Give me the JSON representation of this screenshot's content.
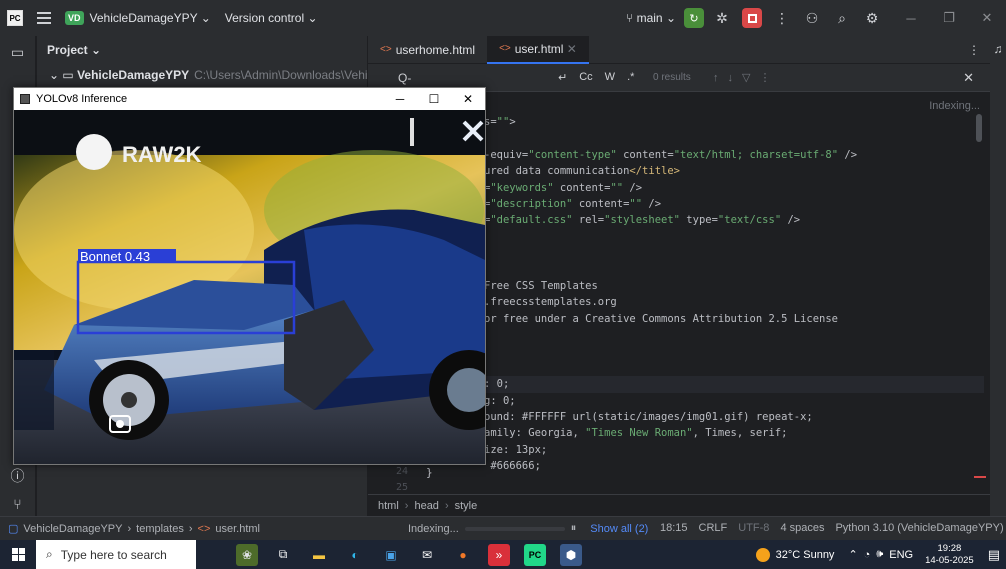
{
  "titlebar": {
    "project_badge": "VD",
    "project_name": "VehicleDamageYPY",
    "version_control": "Version control",
    "branch": "main"
  },
  "project_panel": {
    "title": "Project",
    "root_name": "VehicleDamageYPY",
    "root_path": "C:\\Users\\Admin\\Downloads\\VehicleDamage"
  },
  "editor": {
    "tabs": [
      {
        "label": "userhome.html"
      },
      {
        "label": "user.html"
      }
    ],
    "find": {
      "query_placeholder": "Q-",
      "opt_case": "Cc",
      "opt_word": "W",
      "opt_regex": ".*",
      "results": "0 results"
    },
    "indexing_label": "Indexing...",
    "code_lines": [
      {
        "t": "s=\"\">"
      },
      {
        "t": ""
      },
      {
        "t": "-equiv=\"content-type\" content=\"text/html; charset=utf-8\" />"
      },
      {
        "t": "ured data communication</title>"
      },
      {
        "t": "=\"keywords\" content=\"\" />"
      },
      {
        "t": "=\"description\" content=\"\" />"
      },
      {
        "t": "=\"default.css\" rel=\"stylesheet\" type=\"text/css\" />"
      },
      {
        "t": ""
      },
      {
        "t": ""
      },
      {
        "t": ""
      },
      {
        "t": "Free CSS Templates"
      },
      {
        "t": ".freecsstemplates.org"
      },
      {
        "t": "or free under a Creative Commons Attribution 2.5 License"
      },
      {
        "t": ""
      },
      {
        "t": ""
      },
      {
        "t": ""
      },
      {
        "t": ": 0;"
      },
      {
        "t": "g: 0;"
      },
      {
        "t": "ound: #FFFFFF url(static/images/img01.gif) repeat-x;"
      },
      {
        "t": "amily: Georgia, \"Times New Roman\", Times, serif;"
      },
      {
        "t": "ize: 13px;"
      },
      {
        "t": " #666666;"
      }
    ],
    "gutter": [
      "24",
      "25"
    ],
    "closing_brace": "}",
    "breadcrumb": [
      "html",
      "head",
      "style"
    ]
  },
  "yolo_window": {
    "title": "YOLOv8 Inference",
    "watermark": "RAW2K",
    "detection_label": "Bonnet 0.43"
  },
  "statusbar": {
    "crumbs": [
      "VehicleDamageYPY",
      "templates",
      "user.html"
    ],
    "indexing": "Indexing...",
    "show_all": "Show all (2)",
    "position": "18:15",
    "line_sep": "CRLF",
    "encoding": "UTF-8",
    "indent": "4 spaces",
    "interpreter": "Python 3.10 (VehicleDamageYPY)"
  },
  "taskbar": {
    "search_placeholder": "Type here to search",
    "weather": "32°C Sunny",
    "language": "ENG",
    "time": "19:28",
    "date": "14-05-2025"
  },
  "colors": {
    "accent": "#3574f0",
    "detection_box": "#2a3fd6",
    "green_run": "#4a8f3a",
    "stop_red": "#d94848"
  }
}
